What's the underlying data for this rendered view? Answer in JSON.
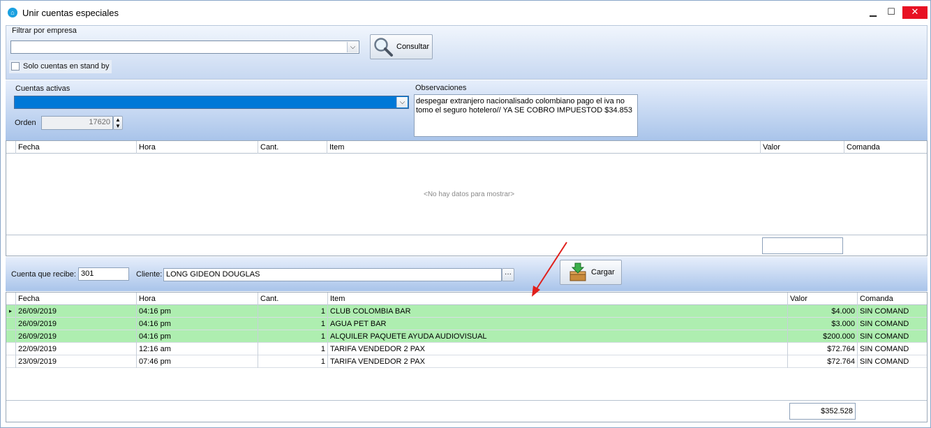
{
  "window": {
    "title": "Unir cuentas especiales",
    "minimize": "▁",
    "maximize": "☐",
    "close": "✕"
  },
  "filter": {
    "group_label": "Filtrar por empresa",
    "empresa_value": "",
    "consultar_label": "Consultar",
    "standby_label": "Solo cuentas en stand by",
    "standby_checked": false
  },
  "cuentas": {
    "activas_label": "Cuentas activas",
    "activas_value": "",
    "orden_label": "Orden",
    "orden_value": "17620",
    "observaciones_label": "Observaciones",
    "observaciones_text": "despegar extranjero nacionalisado colombiano pago el iva no tomo el seguro hotelero// YA SE COBRO IMPUESTOD $34.853"
  },
  "grid_top": {
    "columns": [
      "Fecha",
      "Hora",
      "Cant.",
      "Item",
      "Valor",
      "Comanda"
    ],
    "empty_text": "<No hay datos para mostrar>",
    "total": ""
  },
  "receiver": {
    "cuenta_label": "Cuenta que recibe:",
    "cuenta_value": "301",
    "cliente_label": "Cliente:",
    "cliente_value": "LONG  GIDEON DOUGLAS",
    "ellipsis": "···",
    "cargar_label": "Cargar"
  },
  "grid_bottom": {
    "columns": [
      "Fecha",
      "Hora",
      "Cant.",
      "Item",
      "Valor",
      "Comanda"
    ],
    "rows": [
      {
        "fecha": "26/09/2019",
        "hora": "04:16 pm",
        "cant": "1",
        "item": "CLUB COLOMBIA BAR",
        "valor": "$4.000",
        "comanda": "SIN COMAND",
        "highlight": true
      },
      {
        "fecha": "26/09/2019",
        "hora": "04:16 pm",
        "cant": "1",
        "item": "AGUA PET  BAR",
        "valor": "$3.000",
        "comanda": "SIN COMAND",
        "highlight": true
      },
      {
        "fecha": "26/09/2019",
        "hora": "04:16 pm",
        "cant": "1",
        "item": "ALQUILER PAQUETE AYUDA AUDIOVISUAL",
        "valor": "$200.000",
        "comanda": "SIN COMAND",
        "highlight": true
      },
      {
        "fecha": "22/09/2019",
        "hora": "12:16 am",
        "cant": "1",
        "item": "TARIFA VENDEDOR 2 PAX",
        "valor": "$72.764",
        "comanda": "SIN COMAND",
        "highlight": false
      },
      {
        "fecha": "23/09/2019",
        "hora": "07:46 pm",
        "cant": "1",
        "item": "TARIFA VENDEDOR 2 PAX",
        "valor": "$72.764",
        "comanda": "SIN COMAND",
        "highlight": false
      }
    ],
    "total": "$352.528"
  },
  "colors": {
    "highlight_row": "#aeeeb0",
    "selection_blue": "#0078d7",
    "annotation_arrow": "#e0201c"
  }
}
